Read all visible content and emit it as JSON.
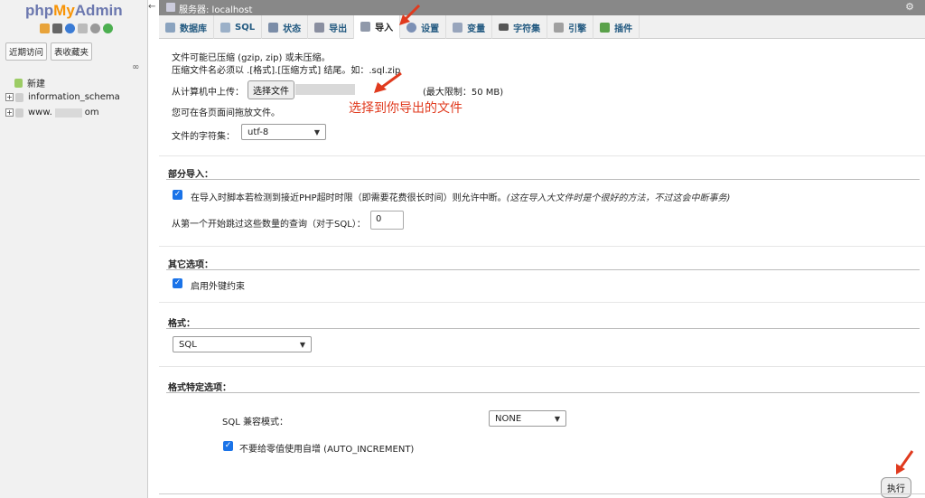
{
  "sidebar": {
    "logo": {
      "php": "php",
      "my": "My",
      "admin": "Admin"
    },
    "recent_label": "近期访问",
    "favorites_label": "表收藏夹",
    "tree": [
      {
        "label": "新建",
        "prefix": "",
        "suffix": ""
      },
      {
        "label": "information_schema",
        "prefix": "",
        "suffix": ""
      },
      {
        "label": "",
        "prefix": "www.",
        "suffix": "om"
      }
    ]
  },
  "topbar": {
    "server_label": "服务器: localhost"
  },
  "tabs": [
    {
      "label": "数据库",
      "icon": "database-icon",
      "active": false
    },
    {
      "label": "SQL",
      "icon": "sql-icon",
      "active": false
    },
    {
      "label": "状态",
      "icon": "status-icon",
      "active": false
    },
    {
      "label": "导出",
      "icon": "export-icon",
      "active": false
    },
    {
      "label": "导入",
      "icon": "import-icon",
      "active": true
    },
    {
      "label": "设置",
      "icon": "settings-icon",
      "active": false
    },
    {
      "label": "变量",
      "icon": "variables-icon",
      "active": false
    },
    {
      "label": "字符集",
      "icon": "charset-icon",
      "active": false
    },
    {
      "label": "引擎",
      "icon": "engine-icon",
      "active": false
    },
    {
      "label": "插件",
      "icon": "plugin-icon",
      "active": false
    }
  ],
  "import_file": {
    "compression_note": "文件可能已压缩 (gzip, zip) 或未压缩。",
    "filename_note": "压缩文件名必须以 .[格式].[压缩方式] 结尾。如：.sql.zip",
    "upload_label": "从计算机中上传：",
    "choose_file_button": "选择文件",
    "max_limit": "(最大限制：50 MB)",
    "drag_note": "您可在各页面间拖放文件。",
    "charset_label": "文件的字符集：",
    "charset_value": "utf-8",
    "annotation": "选择到你导出的文件"
  },
  "partial_import": {
    "title": "部分导入：",
    "interrupt_label": "在导入时脚本若检测到接近PHP超时时限（即需要花费很长时间）则允许中断。",
    "interrupt_hint": "(这在导入大文件时是个很好的方法，不过这会中断事务)",
    "skip_label": "从第一个开始跳过这些数量的查询（对于SQL）：",
    "skip_value": "0"
  },
  "other_options": {
    "title": "其它选项：",
    "fk_label": "启用外键约束"
  },
  "format": {
    "title": "格式：",
    "value": "SQL"
  },
  "format_specific": {
    "title": "格式特定选项：",
    "compat_label": "SQL 兼容模式：",
    "compat_value": "NONE",
    "auto_inc_label": "不要给零值使用自增 (AUTO_INCREMENT)"
  },
  "execute_button": "执行",
  "colors": {
    "accent": "#235a81",
    "annotation": "#e03a1e",
    "checkbox": "#1a73e8"
  }
}
